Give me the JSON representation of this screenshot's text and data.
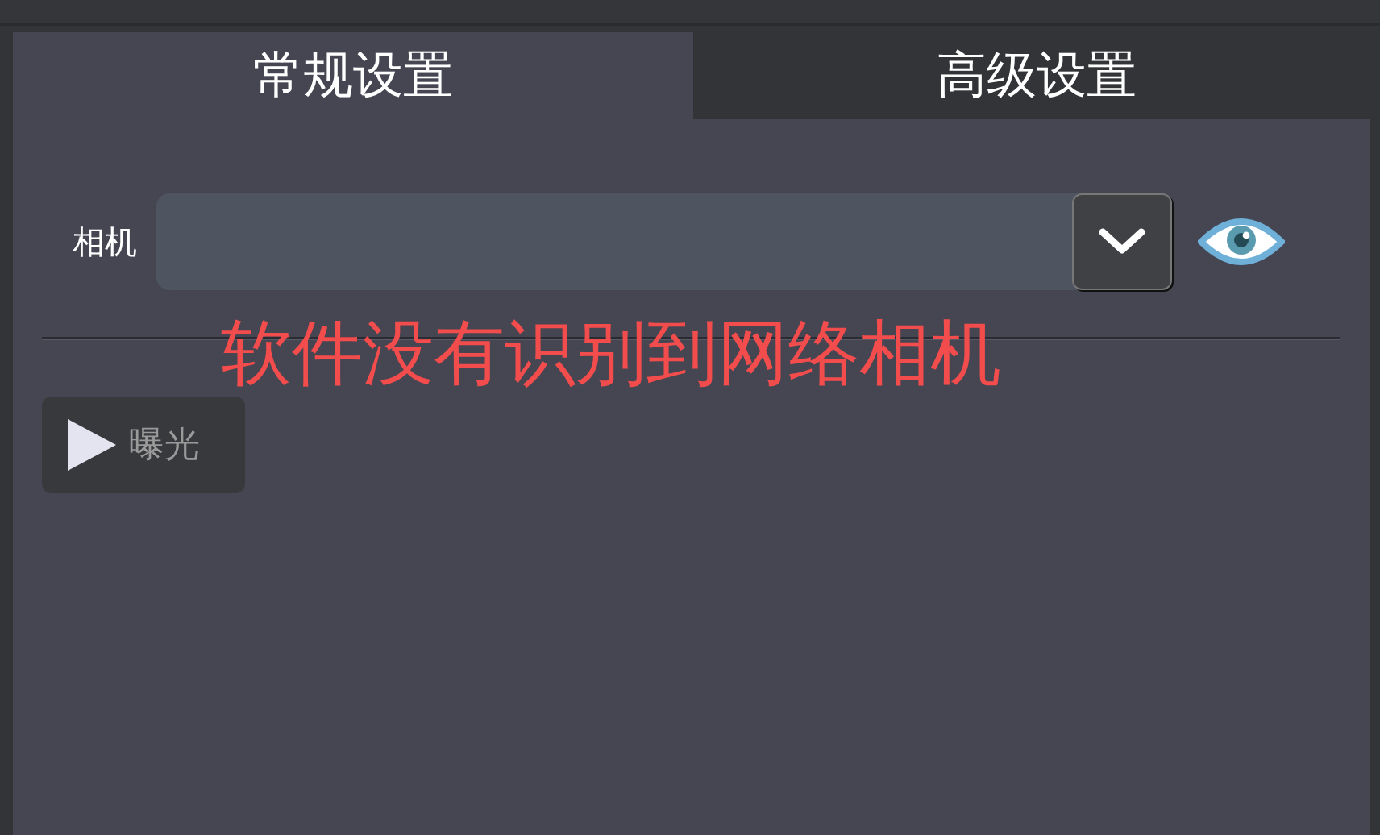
{
  "tabs": [
    {
      "label": "常规设置",
      "selected": true
    },
    {
      "label": "高级设置",
      "selected": false
    }
  ],
  "camera": {
    "label": "相机",
    "disabled": false
  },
  "warning": "软件没有识别到网络相机",
  "exposure_button": {
    "label": "曝光",
    "disabled": true
  }
}
